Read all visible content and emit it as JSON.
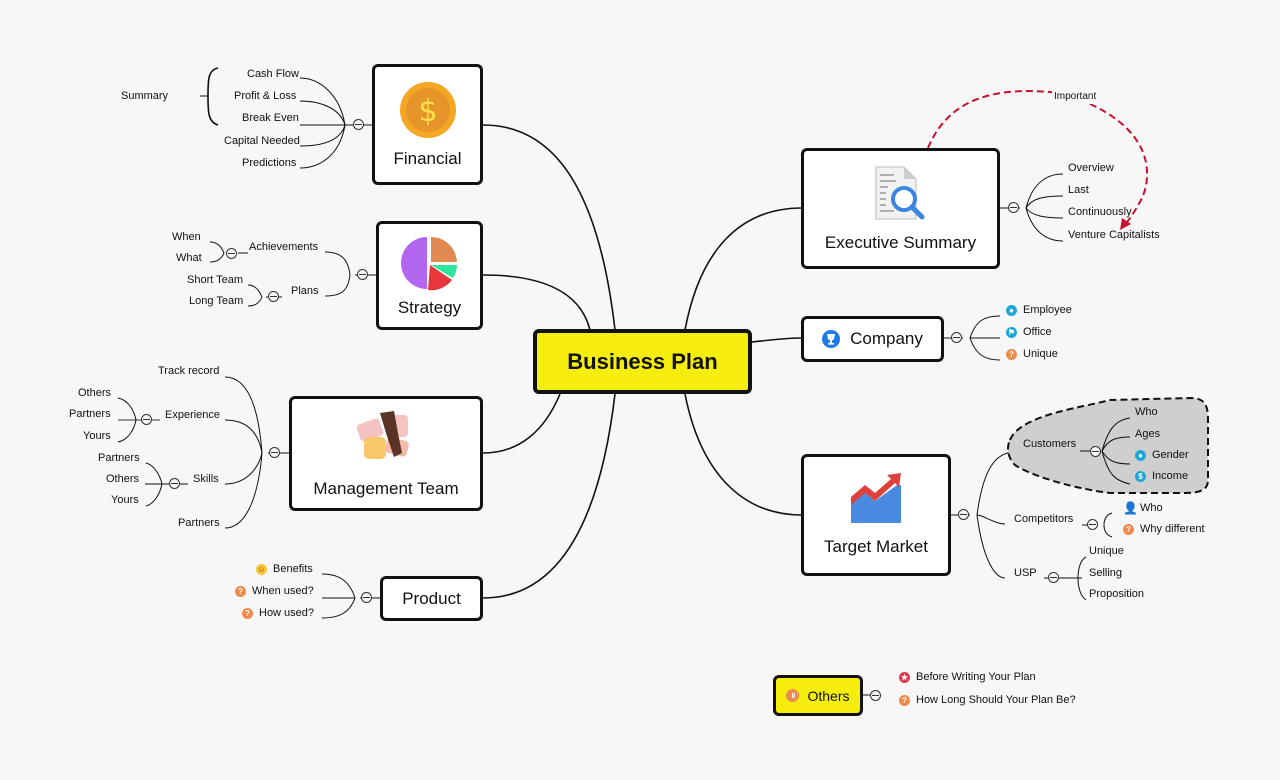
{
  "central": {
    "label": "Business Plan",
    "color": "#f5ee0c"
  },
  "topics": {
    "financial": {
      "label": "Financial",
      "icon": "dollar-coin-icon",
      "children": [
        "Cash Flow",
        "Profit & Loss",
        "Break Even",
        "Capital Needed",
        "Predictions"
      ],
      "summary": "Summary"
    },
    "strategy": {
      "label": "Strategy",
      "icon": "pie-chart-icon",
      "children": [
        {
          "label": "Achievements",
          "children": [
            "When",
            "What"
          ]
        },
        {
          "label": "Plans",
          "children": [
            "Short Team",
            "Long Team"
          ]
        }
      ]
    },
    "management": {
      "label": "Management Team",
      "icon": "team-hands-icon",
      "children": [
        {
          "label": "Track record"
        },
        {
          "label": "Experience",
          "children": [
            "Others",
            "Partners",
            "Yours"
          ]
        },
        {
          "label": "Skills",
          "children": [
            "Partners",
            "Others",
            "Yours"
          ]
        },
        {
          "label": "Partners"
        }
      ]
    },
    "product": {
      "label": "Product",
      "children": [
        {
          "label": "Benefits",
          "marker": "smiley"
        },
        {
          "label": "When used?",
          "marker": "question"
        },
        {
          "label": "How used?",
          "marker": "question"
        }
      ]
    },
    "executive": {
      "label": "Executive Summary",
      "icon": "document-search-icon",
      "children": [
        "Overview",
        "Last",
        "Continuously",
        "Venture Capitalists"
      ],
      "relationship_label": "Important"
    },
    "company": {
      "label": "Company",
      "icon": "trophy-icon",
      "children": [
        {
          "label": "Employee",
          "marker": "person"
        },
        {
          "label": "Office",
          "marker": "flag"
        },
        {
          "label": "Unique",
          "marker": "question"
        }
      ]
    },
    "target": {
      "label": "Target Market",
      "icon": "trend-chart-icon",
      "children": [
        {
          "label": "Customers",
          "children": [
            {
              "label": "Who"
            },
            {
              "label": "Ages"
            },
            {
              "label": "Gender",
              "marker": "person"
            },
            {
              "label": "Income",
              "marker": "dollar"
            }
          ]
        },
        {
          "label": "Competitors",
          "children": [
            {
              "label": "Who",
              "marker": "user-silhouette"
            },
            {
              "label": "Why different",
              "marker": "question"
            }
          ]
        },
        {
          "label": "USP",
          "children": [
            {
              "label": "Unique"
            },
            {
              "label": "Selling"
            },
            {
              "label": "Proposition"
            }
          ]
        }
      ]
    }
  },
  "floating": {
    "label": "Others",
    "children": [
      {
        "label": "Before Writing Your Plan",
        "marker": "star"
      },
      {
        "label": "How Long Should Your Plan Be?",
        "marker": "question"
      }
    ]
  },
  "colors": {
    "question": "#f08a4b",
    "blue_marker": "#1ea7d8",
    "star": "#e0384a",
    "relationship": "#c8102e",
    "boundary_fill": "#cfcfcf"
  }
}
